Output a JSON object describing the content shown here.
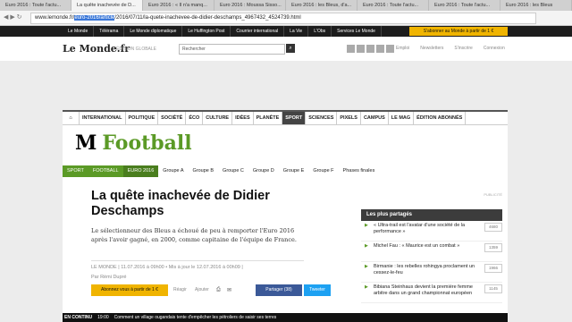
{
  "browser": {
    "tabs": [
      "Euro 2016 : Toute l'actu...",
      "La quête inachevée de D...",
      "Euro 2016 : « Il n'a manq...",
      "Euro 2016 : Moussa Sisso...",
      "Euro 2016 : les Bleus, d'a...",
      "Euro 2016 : Toute l'actu...",
      "Euro 2016 : Toute l'actu...",
      "Euro 2016 : les Bleus"
    ],
    "url_prefix": "www.lemonde.fr/",
    "url_highlight": "euro-2016/article",
    "url_suffix": "/2016/07/11/la-quete-inachevee-de-didier-deschamps_4967432_4524739.html"
  },
  "topnav": {
    "items": [
      "Le Monde",
      "Télérama",
      "Le Monde diplomatique",
      "Le Huffington Post",
      "Courrier international",
      "La Vie",
      "L'Obs",
      "Services Le Monde"
    ],
    "subscribe": "S'abonner au Monde à partir de 1 €"
  },
  "brand": {
    "logo": "Le Monde.fr",
    "edition": "ÉDITION GLOBALE",
    "search_placeholder": "Rechercher",
    "links": [
      "Emploi",
      "Newsletters",
      "S'inscrire",
      "Connexion"
    ]
  },
  "sections": [
    "INTERNATIONAL",
    "POLITIQUE",
    "SOCIÉTÉ",
    "ÉCO",
    "CULTURE",
    "IDÉES",
    "PLANÈTE",
    "SPORT",
    "SCIENCES",
    "PIXELS",
    "CAMPUS",
    "LE MAG",
    "ÉDITION ABONNÉS"
  ],
  "page_title": {
    "mark": "M",
    "text": "Football"
  },
  "breadcrumb": [
    "SPORT",
    "FOOTBALL",
    "EURO 2016"
  ],
  "groups": [
    "Groupe A",
    "Groupe B",
    "Groupe C",
    "Groupe D",
    "Groupe E",
    "Groupe F",
    "Phases finales"
  ],
  "article": {
    "headline": "La quête inachevée de Didier Deschamps",
    "lede": "Le sélectionneur des Bleus a échoué de peu à remporter l'Euro 2016 après l'avoir gagné, en 2000, comme capitaine de l'équipe de France.",
    "meta": "LE MONDE | 11.07.2016 à 09h00 • Mis à jour le 12.07.2016 à 00h09 |",
    "author": "Par Rémi Dupré",
    "subscribe_btn": "Abonnez vous à partir de 1 €",
    "reagir": "Réagir",
    "ajouter": "Ajouter",
    "share_fb": "Partager (38)",
    "share_tw": "Tweeter"
  },
  "sidebar": {
    "pub": "PUBLICITÉ",
    "heading": "Les plus partagés",
    "items": [
      {
        "text": "« Ultra-trail est l'avatar d'une société de la performance »",
        "count": "4680"
      },
      {
        "text": "Michel Fau : « Maurice est un combat »",
        "count": "1359"
      },
      {
        "text": "Birmanie : les rebelles rohingya proclament un cessez-le-feu",
        "count": "1966"
      },
      {
        "text": "Bibiana Steinhaus devient la première femme arbitre dans un grand championnat européen",
        "count": "1145"
      }
    ]
  },
  "ticker": {
    "label": "EN CONTINU",
    "time": "19:00",
    "text": "Comment un village ougandais tente d'empêcher les pétroliers de saisir ses terres"
  }
}
